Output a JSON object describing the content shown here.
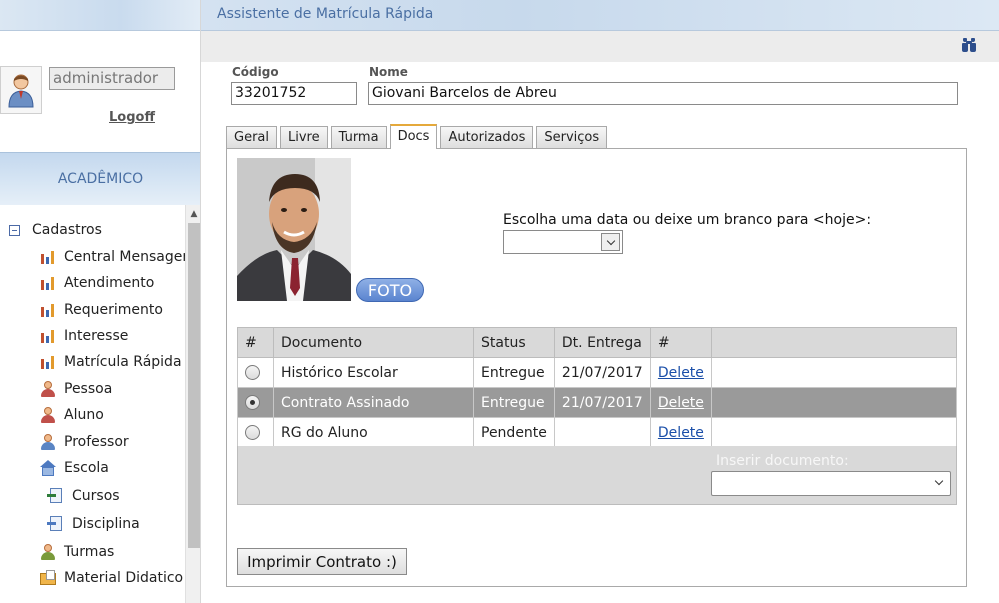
{
  "window": {
    "title": "Assistente de Matrícula Rápida"
  },
  "sidebar": {
    "username": "administrador",
    "logoff_label": "Logoff",
    "section_label": "ACADÊMICO",
    "tree_root_label": "Cadastros",
    "items": [
      {
        "label": "Central Mensagens",
        "icon": "bar-chart-icon"
      },
      {
        "label": "Atendimento",
        "icon": "bar-chart-icon"
      },
      {
        "label": "Requerimento",
        "icon": "bar-chart-icon"
      },
      {
        "label": "Interesse",
        "icon": "bar-chart-icon"
      },
      {
        "label": "Matrícula Rápida",
        "icon": "bar-chart-icon"
      },
      {
        "label": "Pessoa",
        "icon": "person-icon"
      },
      {
        "label": "Aluno",
        "icon": "person-icon"
      },
      {
        "label": "Professor",
        "icon": "teacher-icon"
      },
      {
        "label": "Escola",
        "icon": "school-icon"
      },
      {
        "label": "Cursos",
        "icon": "course-icon"
      },
      {
        "label": "Disciplina",
        "icon": "discipline-icon"
      },
      {
        "label": "Turmas",
        "icon": "group-icon"
      },
      {
        "label": "Material Didatico",
        "icon": "material-icon"
      }
    ]
  },
  "form": {
    "codigo_label": "Código",
    "codigo_value": "33201752",
    "nome_label": "Nome",
    "nome_value": "Giovani Barcelos de Abreu"
  },
  "tabs": [
    {
      "label": "Geral",
      "active": false
    },
    {
      "label": "Livre",
      "active": false
    },
    {
      "label": "Turma",
      "active": false
    },
    {
      "label": "Docs",
      "active": true
    },
    {
      "label": "Autorizados",
      "active": false
    },
    {
      "label": "Serviços",
      "active": false
    }
  ],
  "docs": {
    "foto_button": "FOTO",
    "date_prompt": "Escolha uma data ou deixe um branco para <hoje>:",
    "date_value": "",
    "columns": [
      "#",
      "Documento",
      "Status",
      "Dt. Entrega",
      "#",
      ""
    ],
    "rows": [
      {
        "documento": "Histórico Escolar",
        "status": "Entregue",
        "dt_entrega": "21/07/2017",
        "action": "Delete",
        "selected": false
      },
      {
        "documento": "Contrato Assinado",
        "status": "Entregue",
        "dt_entrega": "21/07/2017",
        "action": "Delete",
        "selected": true
      },
      {
        "documento": "RG do Aluno",
        "status": "Pendente",
        "dt_entrega": "",
        "action": "Delete",
        "selected": false
      }
    ],
    "insert_label": "Inserir documento:",
    "insert_value": "",
    "print_button": "Imprimir Contrato :)"
  },
  "colors": {
    "title_text": "#4a6fa3",
    "active_tab_border": "#e5a93b",
    "selected_row": "#9a9a9a",
    "link": "#1a4ea8",
    "foto_button": "#5a84cf"
  }
}
